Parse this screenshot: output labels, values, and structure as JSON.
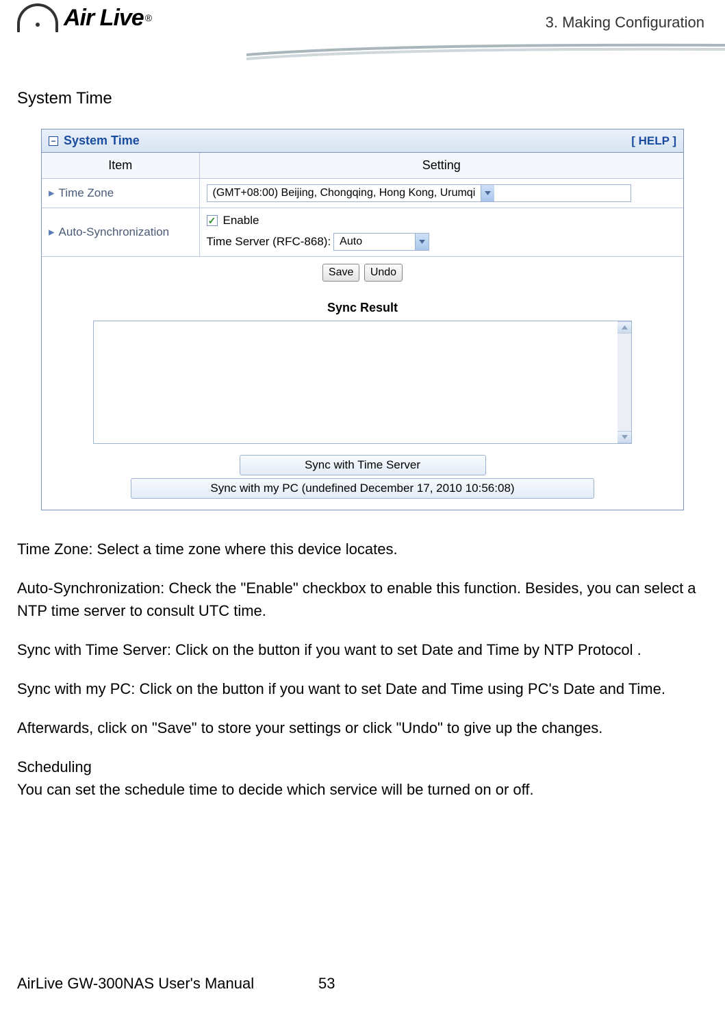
{
  "header": {
    "chapter": "3. Making Configuration",
    "logo_text": "Air Live",
    "logo_reg": "®"
  },
  "section_heading": "System Time",
  "panel": {
    "title": "System Time",
    "help": "[ HELP ]",
    "columns": {
      "item": "Item",
      "setting": "Setting"
    },
    "rows": {
      "timezone": {
        "label": "Time Zone",
        "value": "(GMT+08:00) Beijing, Chongqing, Hong Kong, Urumqi"
      },
      "autosync": {
        "label": "Auto-Synchronization",
        "enable": "Enable",
        "server_label": "Time Server (RFC-868):",
        "server_value": "Auto"
      }
    },
    "buttons": {
      "save": "Save",
      "undo": "Undo"
    },
    "sync_result_title": "Sync Result",
    "sync_buttons": {
      "server": "Sync with Time Server",
      "pc": "Sync with my PC (undefined December 17, 2010 10:56:08)"
    }
  },
  "body": {
    "p1": "Time Zone: Select a time zone where this device locates.",
    "p2": "Auto-Synchronization: Check the \"Enable\" checkbox to enable this function. Besides, you can select a NTP time server to consult UTC time.",
    "p3": "Sync with Time Server: Click on the button if you want to set Date and Time by NTP Protocol .",
    "p4": "Sync with my PC: Click on the button if you want to set Date and Time using PC's Date and Time.",
    "p5": "Afterwards, click on \"Save\" to store your settings or click \"Undo\" to give up the changes.",
    "p6a": "Scheduling",
    "p6b": "You can set the schedule time to decide which service will be turned on or off."
  },
  "footer": {
    "manual": "AirLive GW-300NAS User's Manual",
    "page": "53"
  }
}
